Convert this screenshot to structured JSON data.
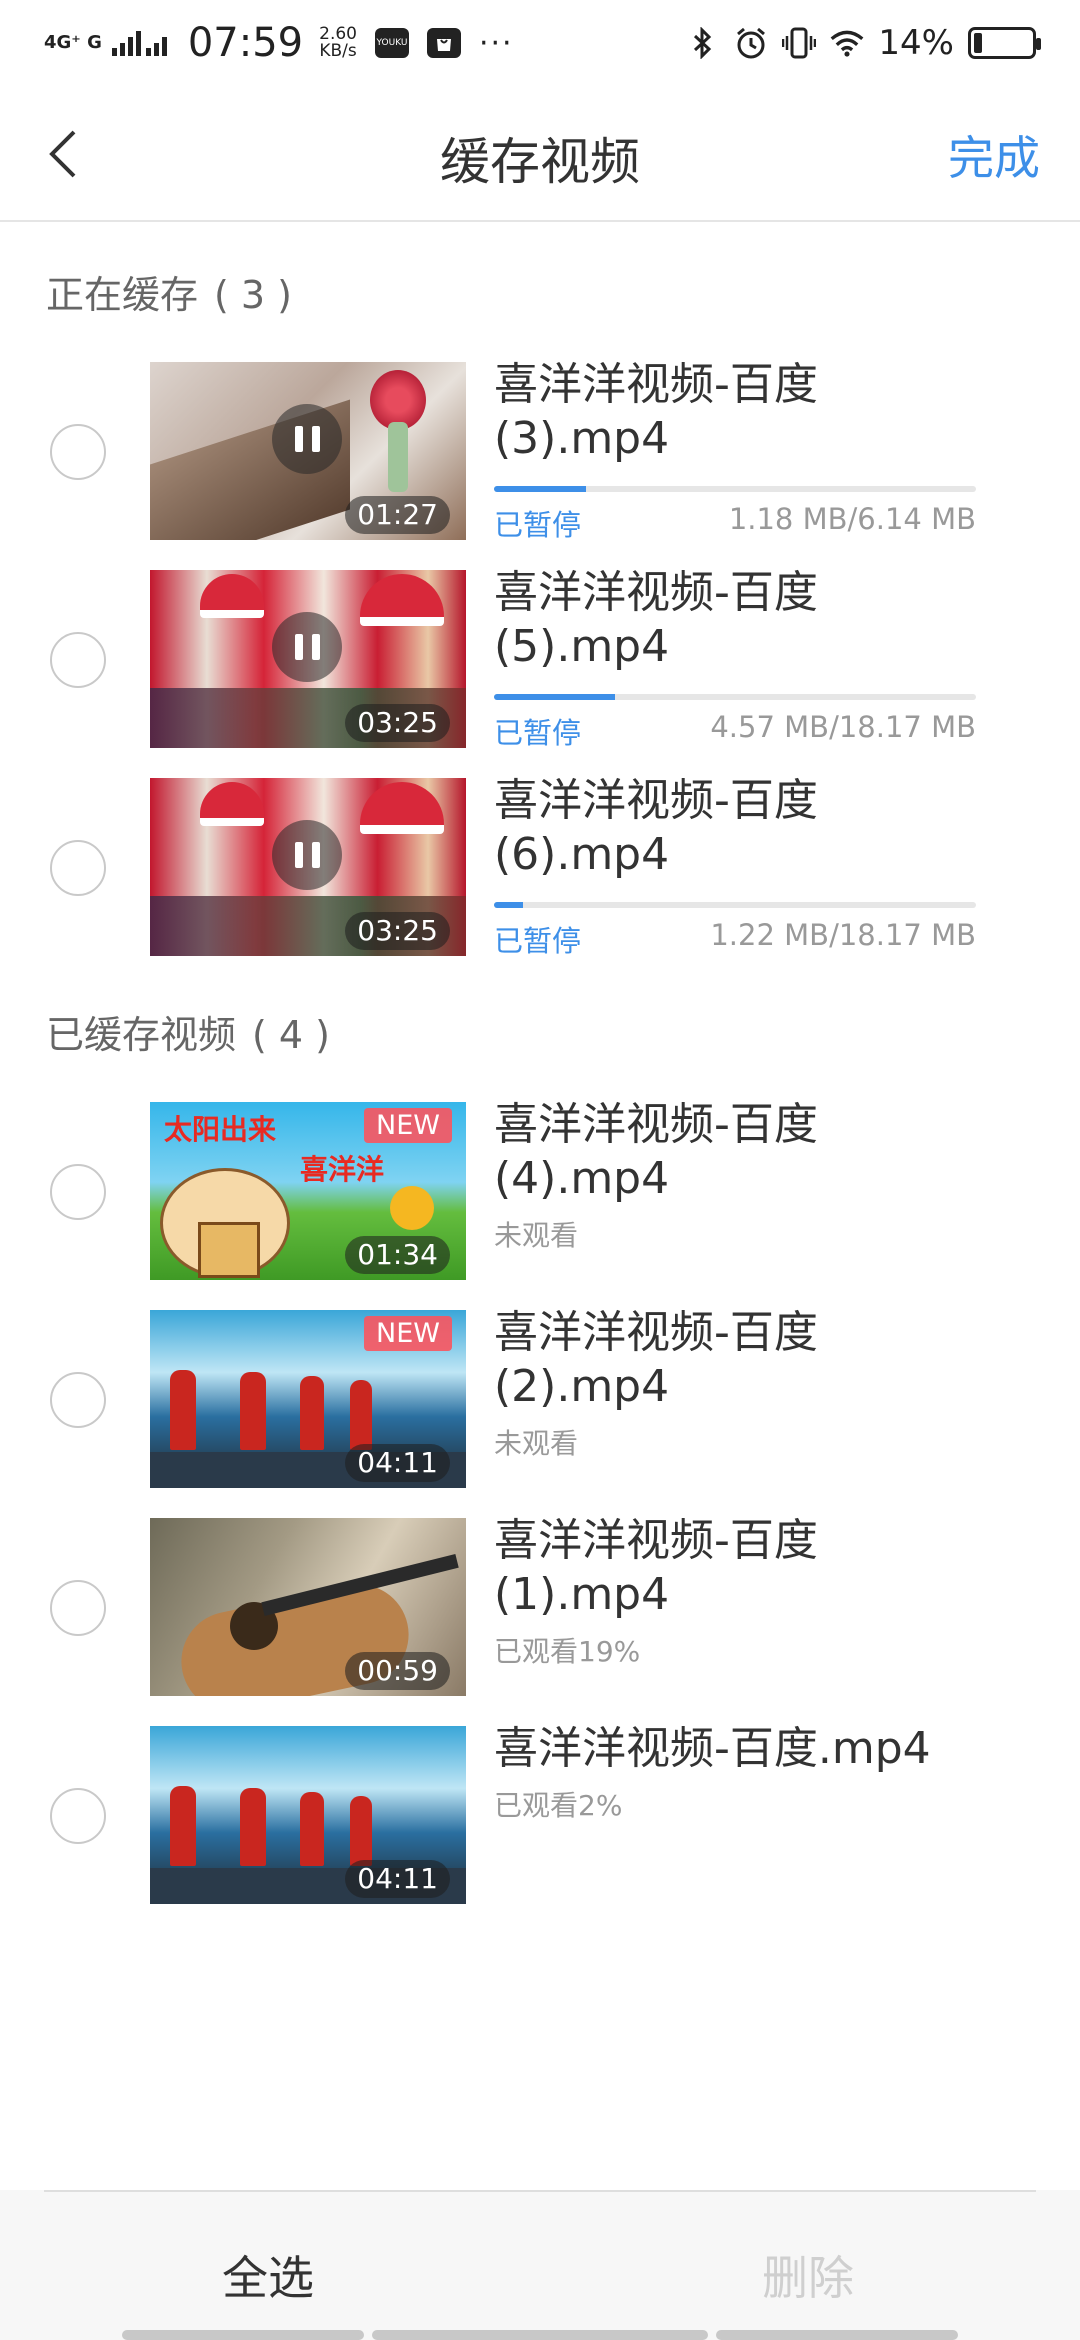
{
  "status_bar": {
    "network": "4G⁺ G",
    "time": "07:59",
    "speed_value": "2.60",
    "speed_unit": "KB/s",
    "app_icon_text": "YOUKU",
    "more": "···",
    "battery_percent": "14%",
    "battery_level": 0.14,
    "icons": [
      "bluetooth-icon",
      "alarm-icon",
      "vibrate-icon",
      "wifi-icon",
      "battery-icon"
    ]
  },
  "header": {
    "title": "缓存视频",
    "done_label": "完成",
    "back_icon": "chevron-left-icon"
  },
  "downloading": {
    "title": "正在缓存",
    "count": "( 3 )",
    "items": [
      {
        "title": "喜洋洋视频-百度(3).mp4",
        "duration": "01:27",
        "status": "已暂停",
        "size": "1.18 MB/6.14 MB",
        "progress": 0.19
      },
      {
        "title": "喜洋洋视频-百度(5).mp4",
        "duration": "03:25",
        "status": "已暂停",
        "size": "4.57 MB/18.17 MB",
        "progress": 0.25
      },
      {
        "title": "喜洋洋视频-百度(6).mp4",
        "duration": "03:25",
        "status": "已暂停",
        "size": "1.22 MB/18.17 MB",
        "progress": 0.06
      }
    ]
  },
  "cached": {
    "title": "已缓存视频",
    "count": "( 4 )",
    "items": [
      {
        "title": "喜洋洋视频-百度(4).mp4",
        "duration": "01:34",
        "badge": "NEW",
        "watch": "未观看",
        "thumb_caption_1": "太阳出来",
        "thumb_caption_2": "喜洋洋"
      },
      {
        "title": "喜洋洋视频-百度(2).mp4",
        "duration": "04:11",
        "badge": "NEW",
        "watch": "未观看"
      },
      {
        "title": "喜洋洋视频-百度(1).mp4",
        "duration": "00:59",
        "watch": "已观看19%"
      },
      {
        "title": "喜洋洋视频-百度.mp4",
        "duration": "04:11",
        "watch": "已观看2%"
      }
    ]
  },
  "bottom_bar": {
    "select_all": "全选",
    "delete": "删除"
  },
  "colors": {
    "accent": "#3d8fe8",
    "new_badge": "#fa555f",
    "muted": "#999999",
    "disabled": "#cfcfcf"
  }
}
